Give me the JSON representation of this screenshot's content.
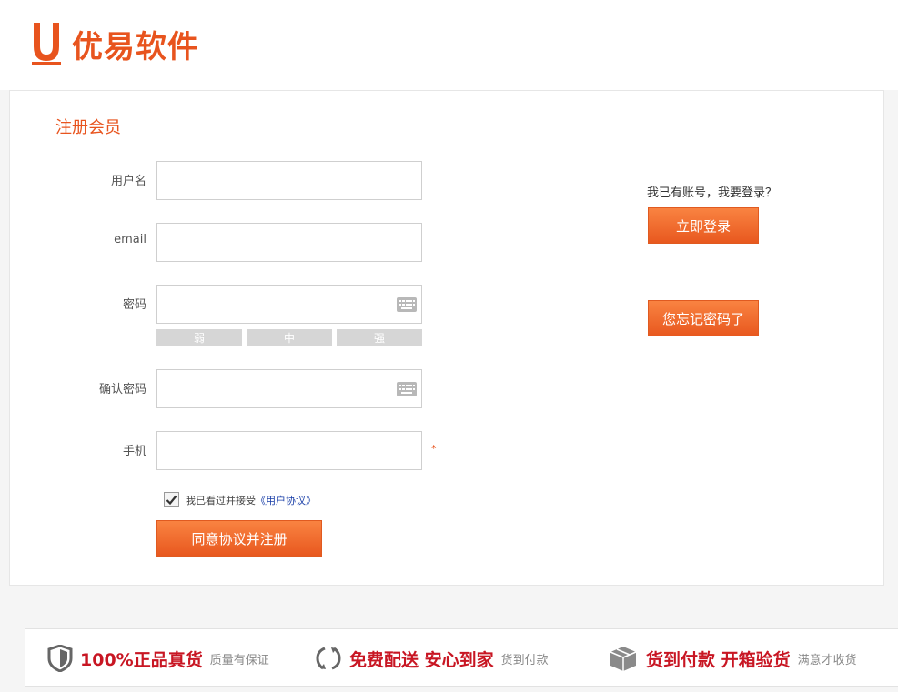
{
  "brand": {
    "name": "优易软件",
    "color": "#e8541e"
  },
  "form": {
    "title": "注册会员",
    "username_label": "用户名",
    "email_label": "email",
    "password_label": "密码",
    "confirm_label": "确认密码",
    "phone_label": "手机",
    "strength": [
      "弱",
      "中",
      "强"
    ],
    "required_mark": "*",
    "agree_text": "我已看过并接受",
    "agree_link": "《用户协议》",
    "agree_checked": true,
    "submit_label": "同意协议并注册"
  },
  "side": {
    "login_prompt": "我已有账号，我要登录？",
    "login_label": "立即登录",
    "forgot_label": "您忘记密码了"
  },
  "footer": {
    "promos": [
      {
        "icon": "shield-icon",
        "main": "100%正品真货",
        "sub": "质量有保证"
      },
      {
        "icon": "refresh-icon",
        "main": "免费配送 安心到家",
        "sub": "货到付款"
      },
      {
        "icon": "package-icon",
        "main": "货到付款 开箱验货",
        "sub": "满意才收货"
      }
    ]
  },
  "colors": {
    "accent": "#e8541e",
    "button": "#f47a36",
    "promo_red": "#c81623"
  }
}
